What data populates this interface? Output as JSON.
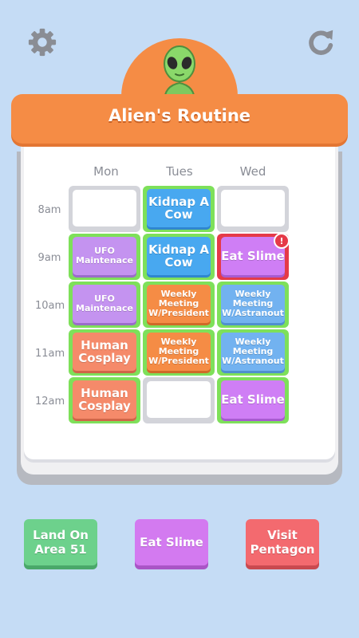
{
  "header": {
    "title": "Alien's Routine"
  },
  "icons": {
    "settings": "gear-icon",
    "restart": "restart-icon",
    "character": "alien"
  },
  "days": [
    "Mon",
    "Tues",
    "Wed"
  ],
  "times": [
    "8am",
    "9am",
    "10am",
    "11am",
    "12am"
  ],
  "schedule": [
    [
      {
        "label": "",
        "state": "empty"
      },
      {
        "label": "Kidnap A Cow",
        "color": "blue",
        "state": "placed"
      },
      {
        "label": "",
        "state": "empty"
      }
    ],
    [
      {
        "label": "UFO Maintenace",
        "color": "lavender",
        "state": "placed"
      },
      {
        "label": "Kidnap A Cow",
        "color": "blue",
        "state": "placed"
      },
      {
        "label": "Eat Slime",
        "color": "purple",
        "state": "conflict"
      }
    ],
    [
      {
        "label": "UFO Maintenace",
        "color": "lavender",
        "state": "placed"
      },
      {
        "label": "Weekly Meeting W/President",
        "color": "orange",
        "state": "placed"
      },
      {
        "label": "Weekly Meeting W/Astranout",
        "color": "lightblue",
        "state": "placed"
      }
    ],
    [
      {
        "label": "Human Cosplay",
        "color": "salmon",
        "state": "placed"
      },
      {
        "label": "Weekly Meeting W/President",
        "color": "orange",
        "state": "placed"
      },
      {
        "label": "Weekly Meeting W/Astranout",
        "color": "lightblue",
        "state": "placed"
      }
    ],
    [
      {
        "label": "Human Cosplay",
        "color": "salmon",
        "state": "placed"
      },
      {
        "label": "",
        "state": "empty"
      },
      {
        "label": "Eat Slime",
        "color": "purple",
        "state": "placed"
      }
    ]
  ],
  "alert_mark": "!",
  "tasks": [
    {
      "label": "Land On Area 51",
      "color": "#6dd18c"
    },
    {
      "label": "Eat Slime",
      "color": "#d37af0"
    },
    {
      "label": "Visit Pentagon",
      "color": "#f36a6f"
    }
  ]
}
